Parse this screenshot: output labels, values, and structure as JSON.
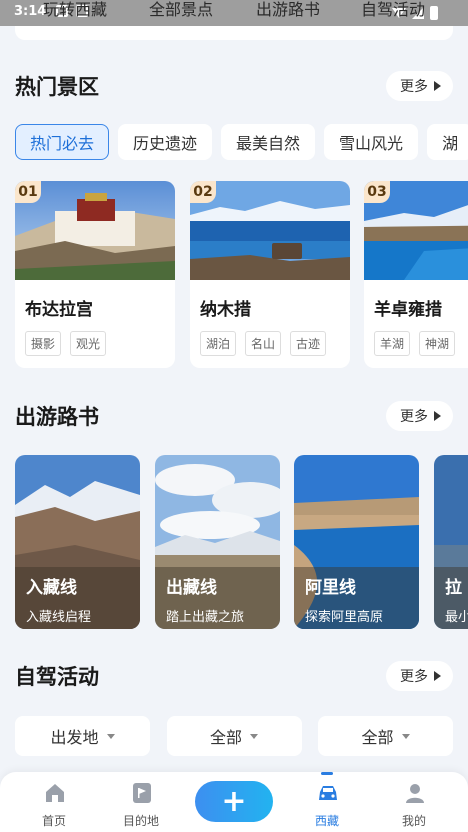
{
  "status": {
    "time": "3:14"
  },
  "top_tabs": [
    "玩转西藏",
    "全部景点",
    "出游路书",
    "自驾活动"
  ],
  "hot_spots": {
    "title": "热门景区",
    "more_label": "更多",
    "chips": [
      {
        "label": "热门必去",
        "active": true
      },
      {
        "label": "历史遗迹",
        "active": false
      },
      {
        "label": "最美自然",
        "active": false
      },
      {
        "label": "雪山风光",
        "active": false
      },
      {
        "label": "湖",
        "active": false
      }
    ],
    "cards": [
      {
        "rank": "01",
        "name": "布达拉宫",
        "tags": [
          "摄影",
          "观光"
        ]
      },
      {
        "rank": "02",
        "name": "纳木措",
        "tags": [
          "湖泊",
          "名山",
          "古迹"
        ]
      },
      {
        "rank": "03",
        "name": "羊卓雍措",
        "tags": [
          "羊湖",
          "神湖"
        ]
      }
    ]
  },
  "routes": {
    "title": "出游路书",
    "more_label": "更多",
    "cards": [
      {
        "name": "入藏线",
        "subtitle": "入藏线启程"
      },
      {
        "name": "出藏线",
        "subtitle": "踏上出藏之旅"
      },
      {
        "name": "阿里线",
        "subtitle": "探索阿里高原"
      },
      {
        "name": "拉",
        "subtitle": "最小"
      }
    ]
  },
  "drive": {
    "title": "自驾活动",
    "more_label": "更多",
    "filters": [
      "出发地",
      "全部",
      "全部"
    ]
  },
  "tabbar": {
    "items": [
      {
        "label": "首页",
        "icon": "home-icon"
      },
      {
        "label": "目的地",
        "icon": "map-flag-icon"
      },
      {
        "label": "西藏",
        "icon": "car-icon",
        "active": true
      },
      {
        "label": "我的",
        "icon": "user-icon"
      }
    ],
    "plus": "+"
  },
  "colors": {
    "accent": "#2a7de1",
    "chip_active_bg": "#e3efff",
    "rank_badge": "#fbe6cc",
    "page_bg": "#f1f4f9"
  }
}
